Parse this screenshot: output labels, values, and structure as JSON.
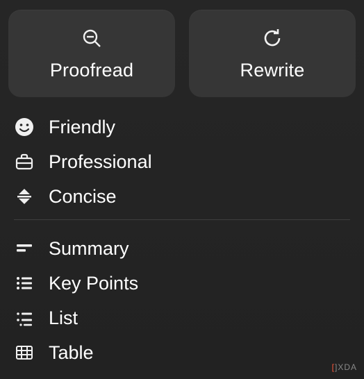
{
  "top_cards": {
    "proofread": {
      "label": "Proofread",
      "icon": "proofread-icon"
    },
    "rewrite": {
      "label": "Rewrite",
      "icon": "rewrite-icon"
    }
  },
  "tone_section": [
    {
      "label": "Friendly",
      "icon": "friendly-icon"
    },
    {
      "label": "Professional",
      "icon": "professional-icon"
    },
    {
      "label": "Concise",
      "icon": "concise-icon"
    }
  ],
  "format_section": [
    {
      "label": "Summary",
      "icon": "summary-icon"
    },
    {
      "label": "Key Points",
      "icon": "keypoints-icon"
    },
    {
      "label": "List",
      "icon": "list-icon"
    },
    {
      "label": "Table",
      "icon": "table-icon"
    }
  ],
  "watermark": {
    "left_bracket": "[",
    "right_bracket": "]",
    "text": "XDA"
  }
}
